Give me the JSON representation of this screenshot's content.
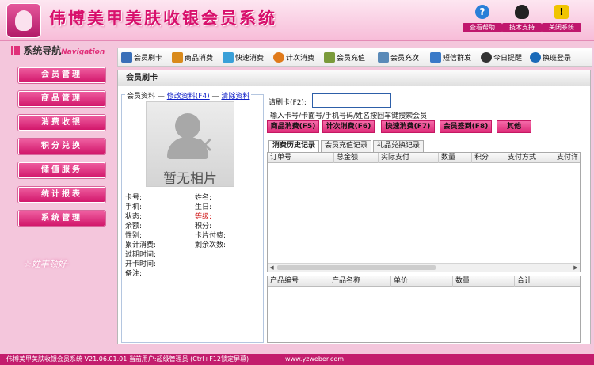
{
  "header": {
    "title": "伟博美甲美肤收银会员系统",
    "buttons": [
      {
        "label": "查看帮助",
        "icon": "help-icon",
        "color": "#2a7fd8"
      },
      {
        "label": "技术支持",
        "icon": "qq-penguin-icon",
        "color": "#222222"
      },
      {
        "label": "关闭系统",
        "icon": "warning-icon",
        "color": "#f0c400"
      }
    ]
  },
  "nav": {
    "title": "系统导航",
    "subtitle": "Navigation",
    "items": [
      "会员管理",
      "商品管理",
      "消费收银",
      "积分兑换",
      "储值服务",
      "统计报表",
      "系统管理"
    ],
    "decoration": "☆姓丰顿好·"
  },
  "toolbar": {
    "items": [
      {
        "label": "会员刷卡",
        "icon": "card-icon",
        "color": "#3a6fb8"
      },
      {
        "label": "商品消费",
        "icon": "goods-icon",
        "color": "#d98a1c"
      },
      {
        "label": "快速消费",
        "icon": "fast-icon",
        "color": "#3aa0d8"
      },
      {
        "label": "计次消费",
        "icon": "count-icon",
        "color": "#e07a1a"
      },
      {
        "label": "会员充值",
        "icon": "recharge-icon",
        "color": "#7a9a3a"
      },
      {
        "label": "会员充次",
        "icon": "charge-count-icon",
        "color": "#5a8ab8"
      },
      {
        "label": "短信群发",
        "icon": "sms-icon",
        "color": "#3a7ac8"
      },
      {
        "label": "今日提醒",
        "icon": "clock-icon",
        "color": "#333333"
      },
      {
        "label": "换班登录",
        "icon": "switch-icon",
        "color": "#1a6ab8"
      }
    ]
  },
  "main": {
    "title": "会员刷卡",
    "member": {
      "legend": "会员资料",
      "edit_link": "修改资料(F4)",
      "clear_link": "清除资料",
      "photo_text": "暂无相片",
      "fields_left": [
        "卡号:",
        "手机:",
        "状态:",
        "余额:",
        "性别:",
        "累计消费:",
        "过期时间:",
        "开卡时间:",
        "备注:"
      ],
      "fields_right": [
        "姓名:",
        "生日:",
        "等级:",
        "积分:",
        "卡片付费:",
        "剩余次数:"
      ]
    },
    "card": {
      "label": "请刷卡(F2):",
      "value": "",
      "hint": "输入卡号/卡面号/手机号码/姓名按回车键搜索会员"
    },
    "actions": [
      "商品消费(F5)",
      "计次消费(F6)",
      "快速消费(F7)",
      "会员签到(F8)",
      "其他"
    ],
    "tabs": [
      "消费历史记录",
      "会员充值记录",
      "礼品兑换记录"
    ],
    "grid1_columns": [
      "订单号",
      "总金额",
      "实际支付",
      "数量",
      "积分",
      "支付方式",
      "支付详"
    ],
    "grid2_columns": [
      "产品编号",
      "产品名称",
      "单价",
      "数量",
      "合计"
    ]
  },
  "status": {
    "text": "伟博美甲美肤收银会员系统 V21.06.01.01 当前用户:超级管理员 (Ctrl+F12锁定屏幕)",
    "website": "www.yzweber.com"
  }
}
